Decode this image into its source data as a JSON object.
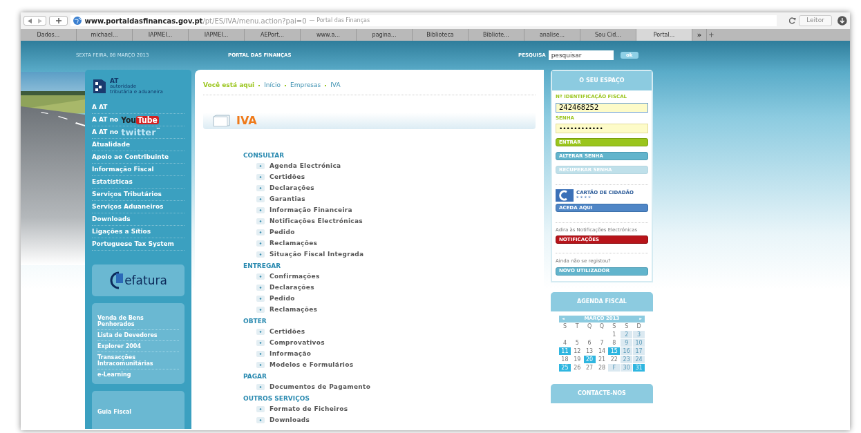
{
  "browser": {
    "url_host": "www.portaldasfinancas.gov.pt",
    "url_path": "/pt/ES/IVA/menu.action?pai=0",
    "url_title": "— Portal das Finanças",
    "reader_button": "Leitor"
  },
  "bookmarks": [
    {
      "label": "Dados...",
      "selected": false
    },
    {
      "label": "michael...",
      "selected": false
    },
    {
      "label": "IAPMEI...",
      "selected": false
    },
    {
      "label": "IAPMEI...",
      "selected": false
    },
    {
      "label": "AEPort...",
      "selected": false
    },
    {
      "label": "www.a...",
      "selected": false
    },
    {
      "label": "pagina...",
      "selected": false
    },
    {
      "label": "Biblioteca",
      "selected": false
    },
    {
      "label": "Bibliote...",
      "selected": false
    },
    {
      "label": "analise...",
      "selected": false
    },
    {
      "label": "Sou Cid...",
      "selected": false
    },
    {
      "label": "Portal...",
      "selected": true
    }
  ],
  "bookmarks_more": "»",
  "new_tab": "+",
  "header": {
    "date": "SEXTA FEIRA, 08 MARÇO 2013",
    "portal_title": "PORTAL DAS FINANÇAS",
    "search_label": "PESQUISA",
    "search_value": "pesquisar",
    "search_button": "ok"
  },
  "logo": {
    "acronym": "AT",
    "line_1": "autoridade",
    "line_2": "tributária e aduaneira"
  },
  "sidebar": {
    "items": [
      {
        "label": "A AT",
        "kind": "text"
      },
      {
        "label": "A AT no",
        "kind": "youtube",
        "logo": [
          "You",
          "Tube"
        ]
      },
      {
        "label": "A AT no",
        "kind": "twitter",
        "logo": [
          "twitter",
          "™"
        ]
      },
      {
        "label": "Atualidade",
        "kind": "text"
      },
      {
        "label": "Apoio ao Contribuinte",
        "kind": "text"
      },
      {
        "label": "Informação Fiscal",
        "kind": "text"
      },
      {
        "label": "Estatísticas",
        "kind": "text"
      },
      {
        "label": "Serviços Tributários",
        "kind": "text"
      },
      {
        "label": "Serviços Aduaneiros",
        "kind": "text"
      },
      {
        "label": "Downloads",
        "kind": "text"
      },
      {
        "label": "Ligações a Sítios",
        "kind": "text"
      },
      {
        "label": "Portuguese Tax System",
        "kind": "text"
      }
    ],
    "efatura_logo": "efatura",
    "links": [
      "Venda de Bens Penhorados",
      "Lista de Devedores",
      "Explorer 2004",
      "Transacções Intracomunitárias",
      "e-Learning"
    ],
    "guide": "Guia Fiscal"
  },
  "breadcrumb": {
    "label": "Você está aqui",
    "items": [
      "Início",
      "Empresas",
      "IVA"
    ]
  },
  "page_title": "IVA",
  "sections": [
    {
      "heading": "CONSULTAR",
      "items": [
        "Agenda Electrónica",
        "Certidões",
        "Declarações",
        "Garantias",
        "Informação Financeira",
        "Notificações Electrónicas",
        "Pedido",
        "Reclamações",
        "Situação Fiscal Integrada"
      ]
    },
    {
      "heading": "ENTREGAR",
      "items": [
        "Confirmações",
        "Declarações",
        "Pedido",
        "Reclamações"
      ]
    },
    {
      "heading": "OBTER",
      "items": [
        "Certidões",
        "Comprovativos",
        "Informação",
        "Modelos e Formulários"
      ]
    },
    {
      "heading": "PAGAR",
      "items": [
        "Documentos de Pagamento"
      ]
    },
    {
      "heading": "OUTROS SERVIÇOS",
      "items": [
        "Formato de Ficheiros",
        "Downloads"
      ]
    }
  ],
  "login": {
    "title": "O SEU ESPAÇO",
    "id_label": "Nº IDENTIFICAÇÃO FISCAL",
    "id_value": "242468252",
    "password_label": "SENHA",
    "password_value": "••••••••••••",
    "buttons": [
      {
        "label": "ENTRAR",
        "kind": "primary",
        "disabled": false
      },
      {
        "label": "ALTERAR SENHA",
        "kind": "secondary",
        "disabled": false
      },
      {
        "label": "RECUPERAR SENHA",
        "kind": "secondary",
        "disabled": true
      }
    ]
  },
  "citizen_card": {
    "label": "CARTÃO DE CIDADÃO",
    "stars": "* * * *",
    "button": "ACEDA AQUI"
  },
  "notifications": {
    "text": "Adira às Notificações Electrónicas",
    "button": "NOTIFICAÇÕES"
  },
  "register": {
    "text": "Ainda não se registou?",
    "button": "NOVO UTILIZADOR"
  },
  "agenda": {
    "title": "AGENDA FISCAL",
    "prev": "◄",
    "month": "MARÇO 2013",
    "next": "►",
    "weekdays": [
      "S",
      "T",
      "Q",
      "Q",
      "S",
      "S",
      "D"
    ],
    "weeks": [
      [
        {
          "kind": "blank"
        },
        {
          "kind": "blank"
        },
        {
          "kind": "blank"
        },
        {
          "kind": "blank"
        },
        {
          "text": "1",
          "kind": "plain"
        },
        {
          "text": "2",
          "kind": "weekend"
        },
        {
          "text": "3",
          "kind": "weekend"
        }
      ],
      [
        {
          "text": "4",
          "kind": "plain"
        },
        {
          "text": "5",
          "kind": "plain"
        },
        {
          "text": "6",
          "kind": "plain"
        },
        {
          "text": "7",
          "kind": "plain"
        },
        {
          "text": "8",
          "kind": "plain"
        },
        {
          "text": "9",
          "kind": "weekend"
        },
        {
          "text": "10",
          "kind": "weekend"
        }
      ],
      [
        {
          "text": "11",
          "kind": "event"
        },
        {
          "text": "12",
          "kind": "plain"
        },
        {
          "text": "13",
          "kind": "plain"
        },
        {
          "text": "14",
          "kind": "plain"
        },
        {
          "text": "15",
          "kind": "event"
        },
        {
          "text": "16",
          "kind": "weekend"
        },
        {
          "text": "17",
          "kind": "weekend"
        }
      ],
      [
        {
          "text": "18",
          "kind": "plain"
        },
        {
          "text": "19",
          "kind": "plain"
        },
        {
          "text": "20",
          "kind": "event"
        },
        {
          "text": "21",
          "kind": "plain"
        },
        {
          "text": "22",
          "kind": "plain"
        },
        {
          "text": "23",
          "kind": "weekend"
        },
        {
          "text": "24",
          "kind": "weekend"
        }
      ],
      [
        {
          "text": "25",
          "kind": "event"
        },
        {
          "text": "26",
          "kind": "plain"
        },
        {
          "text": "27",
          "kind": "plain"
        },
        {
          "text": "28",
          "kind": "plain"
        },
        {
          "text": "F",
          "kind": "weekend"
        },
        {
          "text": "30",
          "kind": "weekend"
        },
        {
          "text": "31",
          "kind": "event"
        }
      ]
    ]
  },
  "contact": {
    "title": "CONTACTE-NOS"
  }
}
